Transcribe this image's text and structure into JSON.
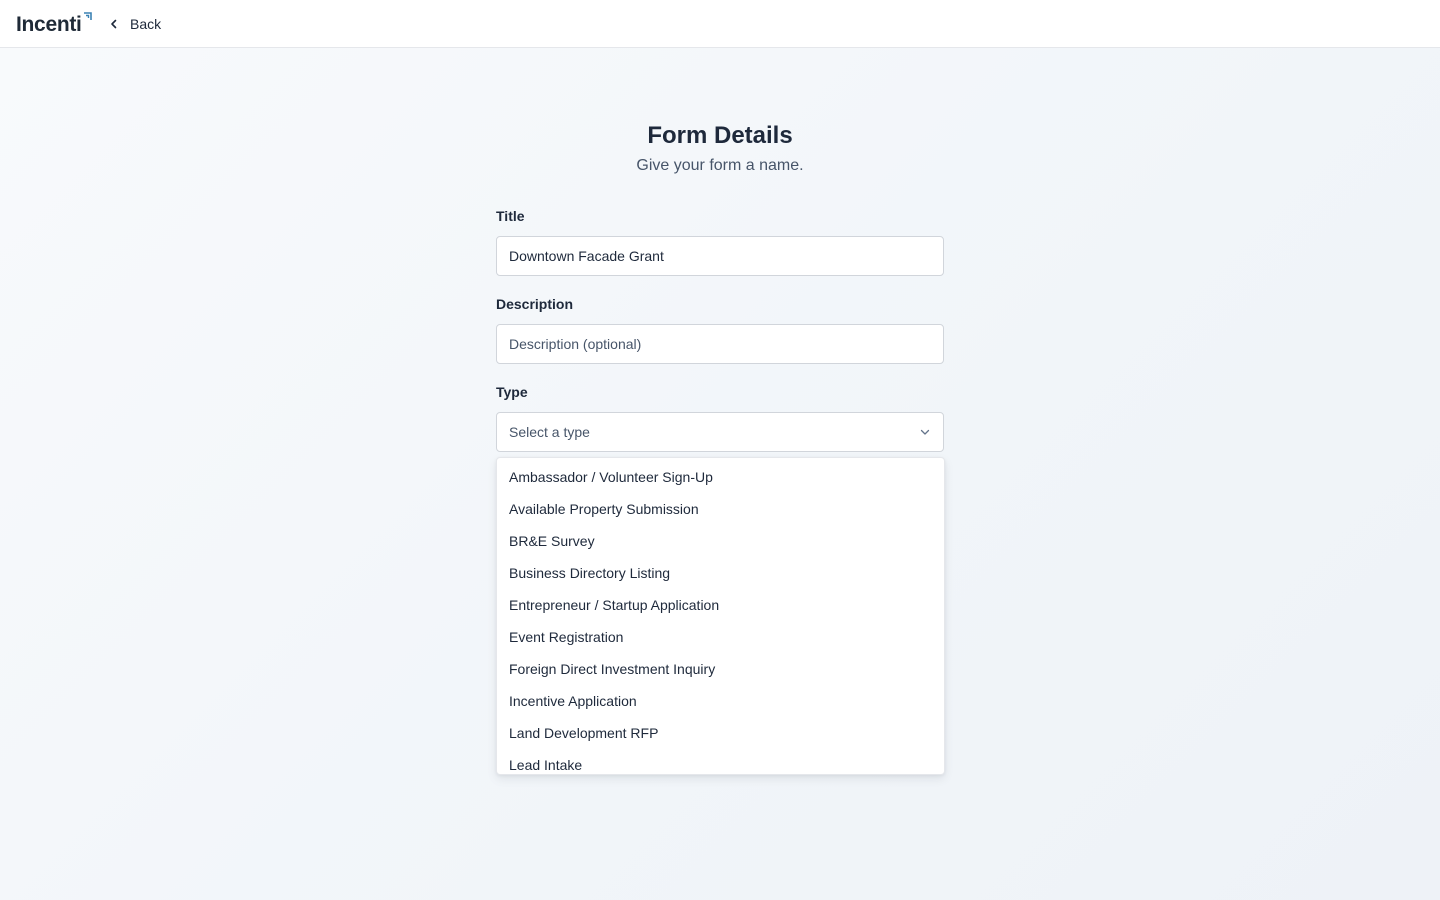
{
  "header": {
    "logo_text": "Incenti",
    "back_label": "Back",
    "icons": {
      "back": "chevron-left-icon",
      "logo_mark": "arrow-up-right-icon"
    }
  },
  "form": {
    "heading": "Form Details",
    "subheading": "Give your form a name.",
    "title": {
      "label": "Title",
      "value": "Downtown Facade Grant"
    },
    "description": {
      "label": "Description",
      "value": "",
      "placeholder": "Description (optional)"
    },
    "type": {
      "label": "Type",
      "placeholder": "Select a type",
      "icon": "chevron-down-icon",
      "options": [
        "Ambassador / Volunteer Sign-Up",
        "Available Property Submission",
        "BR&E Survey",
        "Business Directory Listing",
        "Entrepreneur / Startup Application",
        "Event Registration",
        "Foreign Direct Investment Inquiry",
        "Incentive Application",
        "Land Development RFP",
        "Lead Intake"
      ]
    }
  },
  "colors": {
    "brand_text": "#1f2a37",
    "brand_mark": "#3b82b4",
    "text_primary": "#1e293b",
    "text_muted": "#475569",
    "border": "#d1d5db"
  }
}
